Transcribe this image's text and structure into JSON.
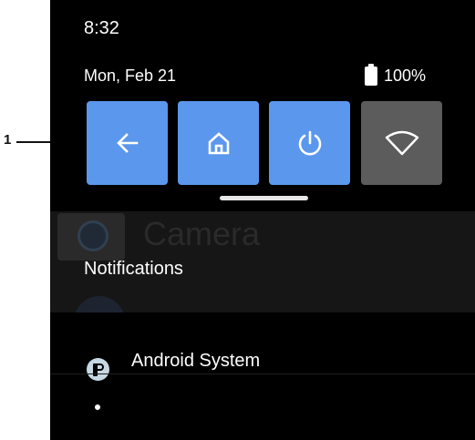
{
  "callout": {
    "label": "1"
  },
  "status": {
    "time": "8:32",
    "date": "Mon, Feb 21",
    "battery_percent": "100%"
  },
  "quick_tiles": [
    {
      "name": "back",
      "icon": "back-arrow-icon",
      "active": true
    },
    {
      "name": "home",
      "icon": "home-icon",
      "active": true
    },
    {
      "name": "power",
      "icon": "power-icon",
      "active": true
    },
    {
      "name": "wifi",
      "icon": "wifi-icon",
      "active": false
    }
  ],
  "background_app": {
    "label": "Camera"
  },
  "notifications": {
    "header": "Notifications",
    "app_name": "Android System"
  },
  "colors": {
    "tile_active": "#5b97ec",
    "tile_inactive": "#5c5c5c",
    "shade_background": "#000000",
    "text": "#ffffff"
  }
}
